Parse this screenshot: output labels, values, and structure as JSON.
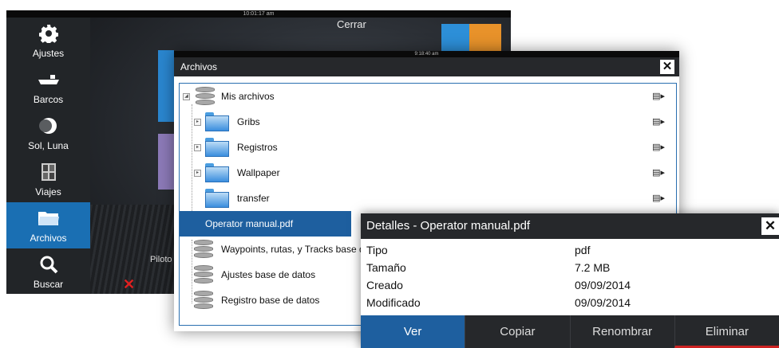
{
  "back_screen": {
    "time": "10:01:17 am",
    "close_label": "Cerrar",
    "autopilot_label": "Piloto",
    "sidebar": [
      {
        "label": "Ajustes",
        "icon": "gear-icon"
      },
      {
        "label": "Barcos",
        "icon": "boat-icon"
      },
      {
        "label": "Sol, Luna",
        "icon": "moon-icon"
      },
      {
        "label": "Viajes",
        "icon": "trip-calculator-icon"
      },
      {
        "label": "Archivos",
        "icon": "folder-icon",
        "active": true
      },
      {
        "label": "Buscar",
        "icon": "search-icon"
      }
    ]
  },
  "files_window": {
    "time": "9:18:40 am",
    "title": "Archivos",
    "close_glyph": "✕",
    "items": [
      {
        "label": "Mis archivos",
        "type": "database"
      },
      {
        "label": "Gribs",
        "type": "folder"
      },
      {
        "label": "Registros",
        "type": "folder"
      },
      {
        "label": "Wallpaper",
        "type": "folder"
      },
      {
        "label": "transfer",
        "type": "folder"
      },
      {
        "label": "Operator manual.pdf",
        "type": "file",
        "selected": true
      },
      {
        "label": "Waypoints, rutas, y Tracks base de",
        "type": "database"
      },
      {
        "label": "Ajustes base de datos",
        "type": "database"
      },
      {
        "label": "Registro base de datos",
        "type": "database"
      }
    ]
  },
  "details_panel": {
    "title": "Detalles - Operator manual.pdf",
    "close_glyph": "✕",
    "fields": [
      {
        "key": "Tipo",
        "value": "pdf"
      },
      {
        "key": "Tamaño",
        "value": "7.2 MB"
      },
      {
        "key": "Creado",
        "value": "09/09/2014"
      },
      {
        "key": "Modificado",
        "value": "09/09/2014"
      }
    ],
    "buttons": {
      "view": "Ver",
      "copy": "Copiar",
      "rename": "Renombrar",
      "delete": "Eliminar"
    }
  },
  "colors": {
    "accent": "#1e5f9f",
    "titlebar": "#26282b",
    "delete_underline": "#cc2222"
  }
}
